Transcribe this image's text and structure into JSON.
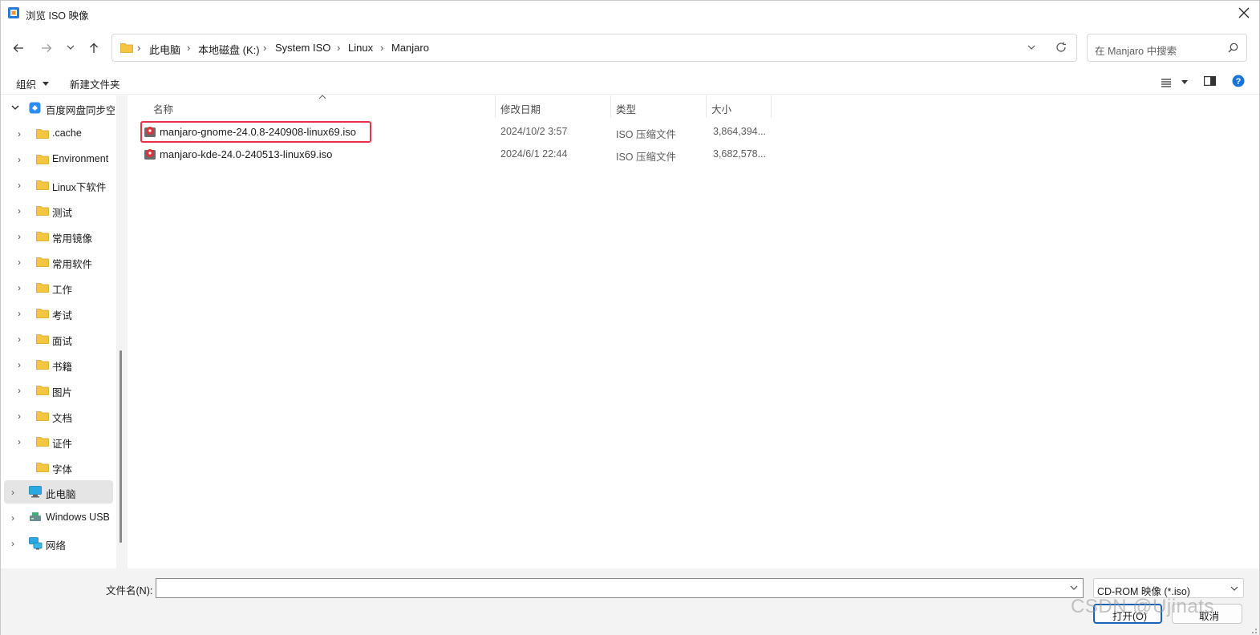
{
  "window": {
    "title": "浏览 ISO 映像"
  },
  "address_bar": {
    "crumbs": [
      "此电脑",
      "本地磁盘 (K:)",
      "System ISO",
      "Linux",
      "Manjaro"
    ]
  },
  "search": {
    "placeholder": "在 Manjaro 中搜索"
  },
  "toolbar": {
    "organize_label": "组织",
    "new_folder_label": "新建文件夹"
  },
  "sidebar": {
    "items": [
      {
        "label": "百度网盘同步空",
        "icon": "baidu-netdisk-icon"
      },
      {
        "label": ".cache",
        "icon": "folder-icon"
      },
      {
        "label": "Environment",
        "icon": "folder-icon"
      },
      {
        "label": "Linux下软件",
        "icon": "folder-icon"
      },
      {
        "label": "测试",
        "icon": "folder-icon"
      },
      {
        "label": "常用镜像",
        "icon": "folder-icon"
      },
      {
        "label": "常用软件",
        "icon": "folder-icon"
      },
      {
        "label": "工作",
        "icon": "folder-icon"
      },
      {
        "label": "考试",
        "icon": "folder-icon"
      },
      {
        "label": "面试",
        "icon": "folder-icon"
      },
      {
        "label": "书籍",
        "icon": "folder-icon"
      },
      {
        "label": "图片",
        "icon": "folder-icon"
      },
      {
        "label": "文档",
        "icon": "folder-icon"
      },
      {
        "label": "证件",
        "icon": "folder-icon"
      },
      {
        "label": "字体",
        "icon": "folder-icon"
      },
      {
        "label": "此电脑",
        "icon": "computer-icon"
      },
      {
        "label": "Windows USB",
        "icon": "usb-drive-icon"
      },
      {
        "label": "网络",
        "icon": "network-icon"
      }
    ]
  },
  "columns": {
    "name": "名称",
    "date": "修改日期",
    "type": "类型",
    "size": "大小"
  },
  "files": [
    {
      "name": "manjaro-gnome-24.0.8-240908-linux69.iso",
      "date": "2024/10/2 3:57",
      "type": "ISO 压缩文件",
      "size": "3,864,394...",
      "icon": "iso-file-icon"
    },
    {
      "name": "manjaro-kde-24.0-240513-linux69.iso",
      "date": "2024/6/1 22:44",
      "type": "ISO 压缩文件",
      "size": "3,682,578...",
      "icon": "iso-file-icon"
    }
  ],
  "bottom": {
    "filename_label": "文件名(N):",
    "filename_value": "",
    "filter_label": "CD-ROM 映像 (*.iso)",
    "open_label": "打开(O)",
    "cancel_label": "取消"
  },
  "watermark": "CSDN @Ujinats",
  "colors": {
    "highlight": "#e8304b",
    "folder": "#f4c542",
    "accent": "#1a62b8"
  }
}
